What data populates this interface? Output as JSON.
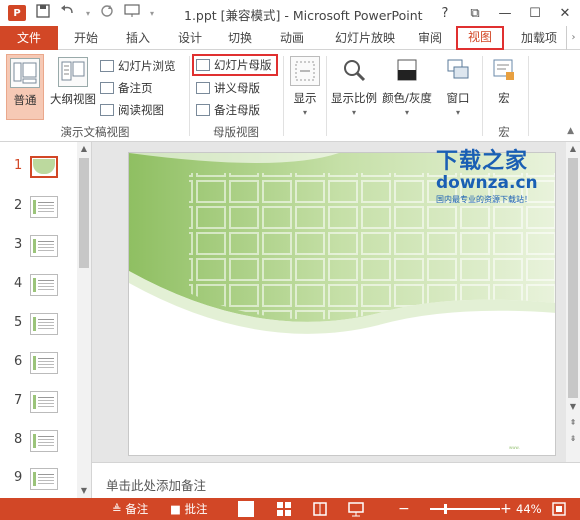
{
  "window": {
    "title": "1.ppt [兼容模式] - Microsoft PowerPoint",
    "app_icon_text": "P",
    "controls": [
      "?",
      "⧉",
      "—",
      "☐",
      "✕"
    ]
  },
  "qat": {
    "icons": [
      "save-icon",
      "undo-icon",
      "redo-icon",
      "start-from-beginning-icon"
    ]
  },
  "tabs": [
    {
      "label": "文件"
    },
    {
      "label": "开始"
    },
    {
      "label": "插入"
    },
    {
      "label": "设计"
    },
    {
      "label": "切换"
    },
    {
      "label": "动画"
    },
    {
      "label": "幻灯片放映"
    },
    {
      "label": "审阅"
    },
    {
      "label": "视图",
      "active": true
    },
    {
      "label": "加载项"
    }
  ],
  "ribbon": {
    "presentation_views": {
      "label": "演示文稿视图",
      "normal": "普通",
      "outline": "大纲视图",
      "sorter": "幻灯片浏览",
      "notes_page": "备注页",
      "reading": "阅读视图"
    },
    "master_views": {
      "label": "母版视图",
      "slide_master": "幻灯片母版",
      "handout_master": "讲义母版",
      "notes_master": "备注母版"
    },
    "show": {
      "label": "显示"
    },
    "zoom": {
      "label": "显示比例"
    },
    "color": {
      "label": "颜色/灰度"
    },
    "window": {
      "label": "窗口"
    },
    "macros": {
      "label": "宏",
      "group_label": "宏"
    }
  },
  "thumbnails": {
    "numbers": [
      "1",
      "2",
      "3",
      "4",
      "5",
      "6",
      "7",
      "8",
      "9"
    ]
  },
  "notes": {
    "placeholder": "单击此处添加备注"
  },
  "watermark": {
    "brand": "下载之家",
    "url": "downza.cn",
    "tagline": "国内最专业的资源下载站！"
  },
  "statusbar": {
    "notes": "备注",
    "comments": "批注",
    "zoom_level": "44%",
    "zoom_fraction": 0.44
  },
  "colors": {
    "accent": "#d24726",
    "highlight_box": "#e03030",
    "slide_green": "#9bc47a"
  }
}
